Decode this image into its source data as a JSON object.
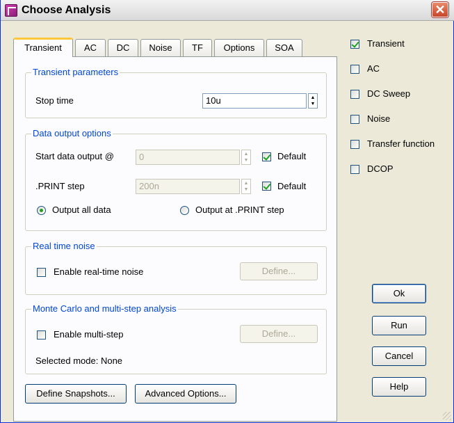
{
  "window": {
    "title": "Choose Analysis",
    "close_glyph": "✕"
  },
  "tabs": [
    "Transient",
    "AC",
    "DC",
    "Noise",
    "TF",
    "Options",
    "SOA"
  ],
  "transient_params": {
    "group": "Transient parameters",
    "stop_time_label": "Stop time",
    "stop_time_value": "10u"
  },
  "data_output": {
    "group": "Data output options",
    "start_label": "Start data output @",
    "start_value": "0",
    "start_default_label": "Default",
    "start_default_checked": true,
    "print_label": ".PRINT step",
    "print_value": "200n",
    "print_default_label": "Default",
    "print_default_checked": true,
    "radio_all_label": "Output all data",
    "radio_print_label": "Output at .PRINT step",
    "radio_selected": "all"
  },
  "noise": {
    "group": "Real time noise",
    "enable_label": "Enable real-time noise",
    "enable_checked": false,
    "define_label": "Define..."
  },
  "monte_carlo": {
    "group": "Monte Carlo and multi-step analysis",
    "enable_label": "Enable multi-step",
    "enable_checked": false,
    "define_label": "Define...",
    "mode_text": "Selected mode: None"
  },
  "bottom_buttons": {
    "snapshots": "Define Snapshots...",
    "advanced": "Advanced Options..."
  },
  "analyses": [
    {
      "label": "Transient",
      "checked": true
    },
    {
      "label": "AC",
      "checked": false
    },
    {
      "label": "DC Sweep",
      "checked": false
    },
    {
      "label": "Noise",
      "checked": false
    },
    {
      "label": "Transfer function",
      "checked": false
    },
    {
      "label": "DCOP",
      "checked": false
    }
  ],
  "actions": {
    "ok": "Ok",
    "run": "Run",
    "cancel": "Cancel",
    "help": "Help"
  },
  "colors": {
    "group_title": "#0046d5",
    "check_mark": "#21a121",
    "tab_highlight": "#ffc83c"
  }
}
